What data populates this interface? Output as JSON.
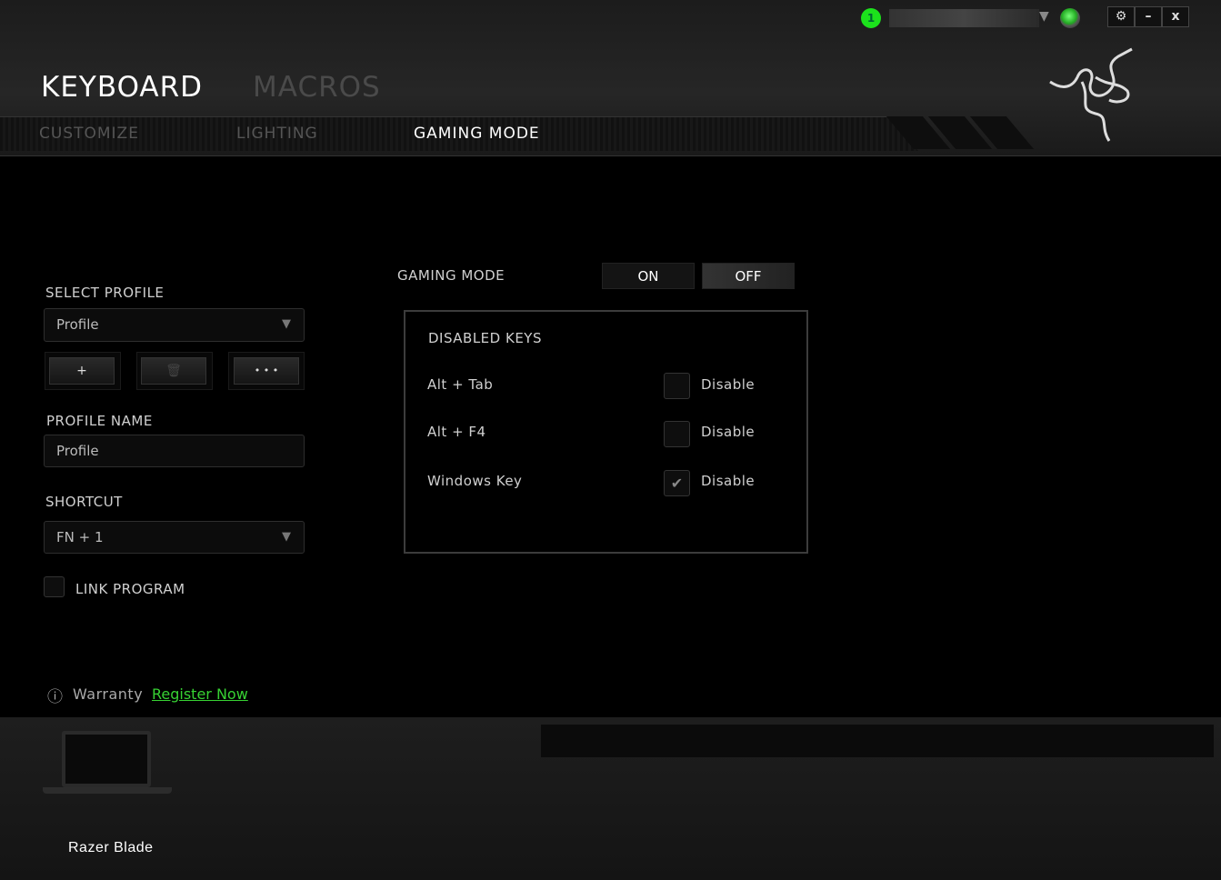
{
  "header": {
    "tabs": [
      {
        "label": "KEYBOARD",
        "active": true
      },
      {
        "label": "MACROS",
        "active": false
      }
    ],
    "subtabs": [
      {
        "label": "CUSTOMIZE",
        "active": false
      },
      {
        "label": "LIGHTING",
        "active": false
      },
      {
        "label": "GAMING MODE",
        "active": true
      }
    ],
    "profile_indicator": "1",
    "window_buttons": {
      "settings": "⚙",
      "minimize": "–",
      "close": "x"
    }
  },
  "profile": {
    "select_label": "SELECT PROFILE",
    "selected": "Profile",
    "add": "+",
    "delete": "🗑",
    "more": "• • •",
    "name_label": "PROFILE NAME",
    "name_value": "Profile",
    "shortcut_label": "SHORTCUT",
    "shortcut_value": "FN + 1",
    "link_program": "LINK PROGRAM",
    "link_program_checked": false
  },
  "gaming_mode": {
    "label": "GAMING MODE",
    "on": "ON",
    "off": "OFF",
    "state": "OFF",
    "disabled_keys_title": "DISABLED KEYS",
    "keys": [
      {
        "name": "Alt + Tab",
        "option": "Disable",
        "checked": false
      },
      {
        "name": "Alt + F4",
        "option": "Disable",
        "checked": false
      },
      {
        "name": "Windows Key",
        "option": "Disable",
        "checked": true
      }
    ]
  },
  "warranty": {
    "label": "Warranty",
    "link": "Register Now",
    "link_color": "#37d233"
  },
  "device": {
    "name": "Razer Blade"
  }
}
